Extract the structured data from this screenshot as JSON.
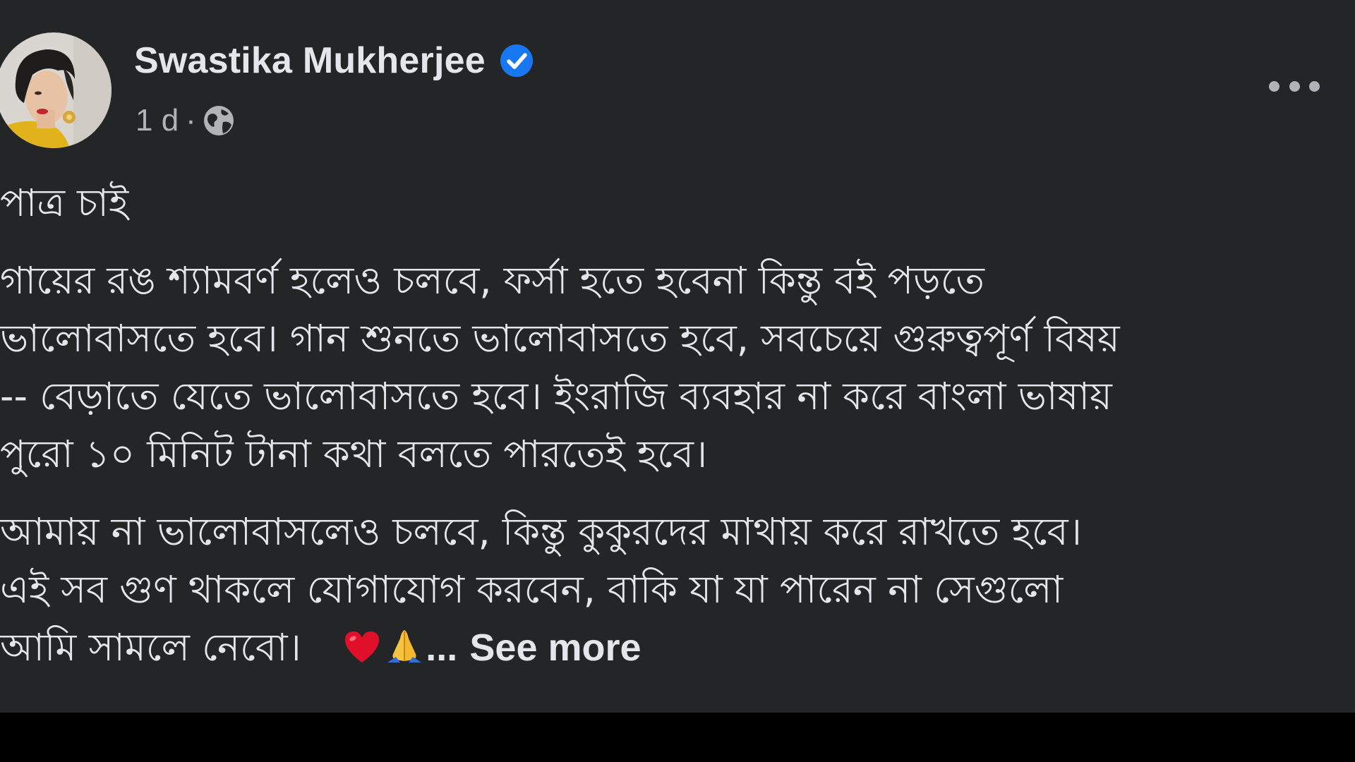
{
  "post": {
    "author": "Swastika Mukherjee",
    "verified_icon": "verified-badge-icon",
    "timestamp": "1 d",
    "separator": "·",
    "audience_icon": "globe-icon",
    "more_icon": "more-options-icon",
    "paragraphs": [
      {
        "lines": [
          "পাত্র চাই"
        ]
      },
      {
        "lines": [
          "গায়ের রঙ শ্যামবর্ণ হলেও চলবে, ফর্সা হতে হবেনা কিন্তু বই পড়তে",
          "ভালোবাসতে হবে। গান শুনতে ভালোবাসতে হবে, সবচেয়ে গুরুত্বপূর্ণ বিষয়",
          "-- বেড়াতে যেতে ভালোবাসতে হবে। ইংরাজি ব্যবহার না করে বাংলা ভাষায়",
          "পুরো ১০ মিনিট টানা কথা বলতে পারতেই হবে।"
        ]
      },
      {
        "lines": [
          "আমায় না ভালোবাসলেও চলবে, কিন্তু কুকুরদের মাথায় করে রাখতে হবে।",
          "এই সব গুণ থাকলে যোগাযোগ করবেন, বাকি যা যা পারেন না সেগুলো"
        ]
      }
    ],
    "closing": {
      "text": "আমি সামলে নেবো।",
      "emojis": [
        "heart-emoji-icon",
        "folded-hands-emoji-icon"
      ],
      "ellipsis": "...",
      "see_more": "See more"
    }
  },
  "colors": {
    "background": "#242526",
    "bottom_band": "#000000",
    "primary_text": "#e4e6eb",
    "secondary_text": "#b0b3b8",
    "verified_blue": "#1877f2"
  }
}
